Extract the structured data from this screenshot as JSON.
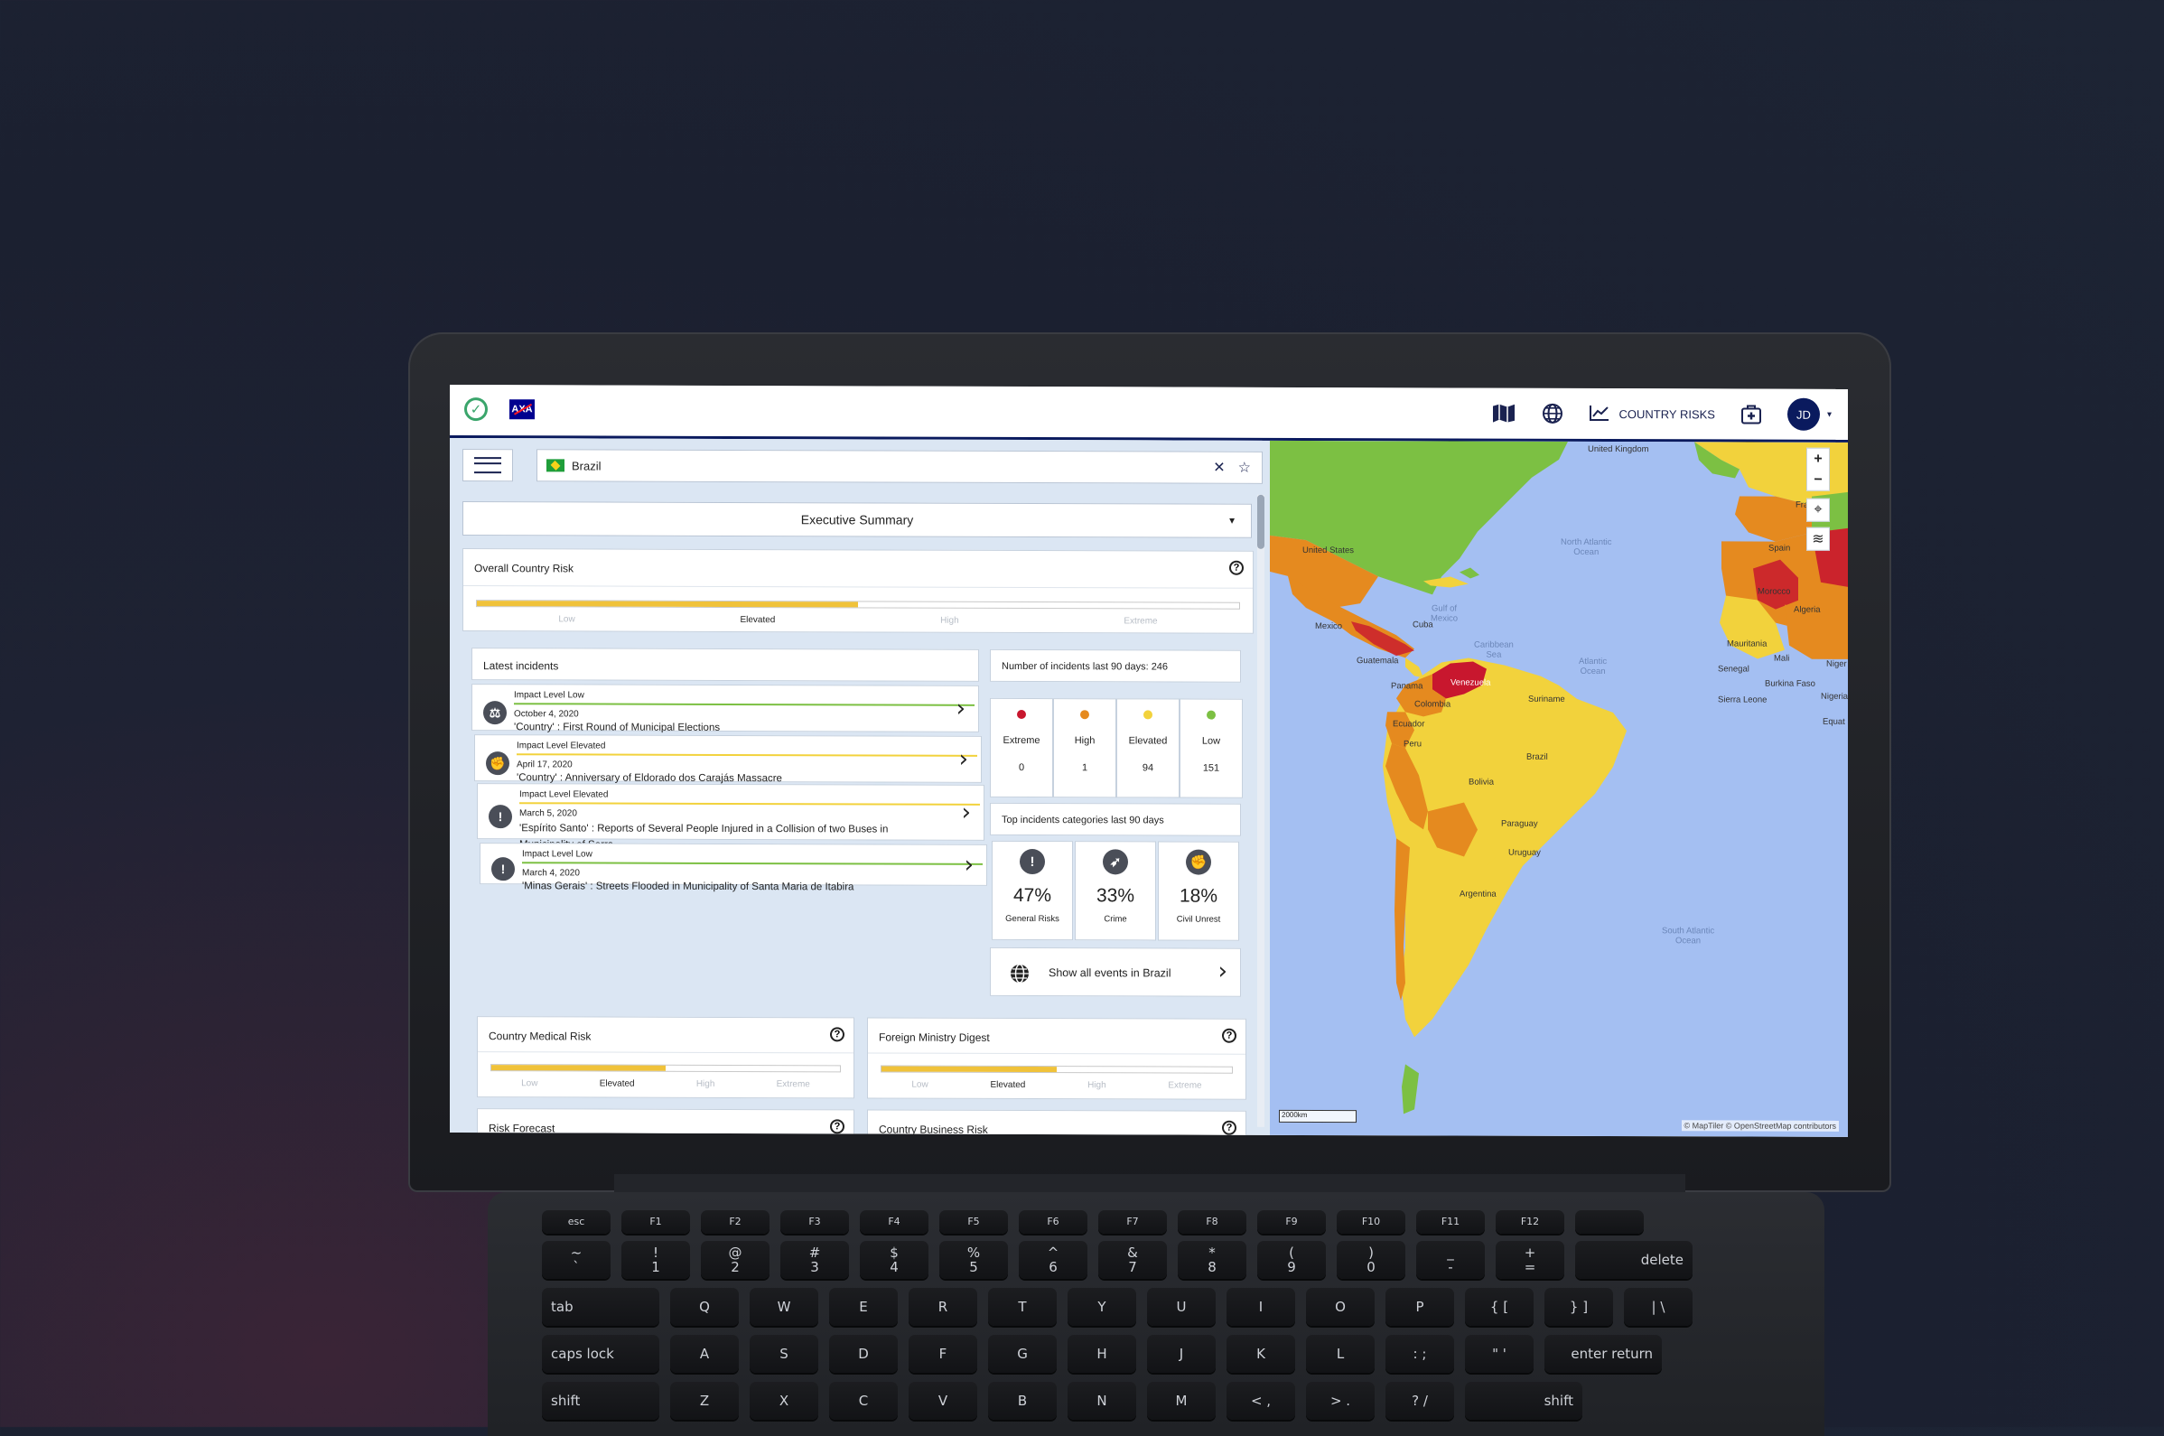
{
  "app": {
    "nav": {
      "country_risks": "COUNTRY RISKS",
      "avatar_initials": "JD",
      "icons": [
        "map-icon",
        "globe-icon",
        "chart-icon",
        "medical-kit-icon"
      ]
    },
    "brand_color": "#0a1a5e",
    "accent_green": "#3aa56b"
  },
  "search": {
    "country": "Brazil"
  },
  "section_select": {
    "value": "Executive Summary"
  },
  "overall_risk": {
    "title": "Overall Country Risk",
    "level_fraction": 0.5,
    "scale": [
      "Low",
      "Elevated",
      "High",
      "Extreme"
    ],
    "active": "Elevated"
  },
  "latest_incidents": {
    "title": "Latest incidents",
    "items": [
      {
        "level": "Impact Level Low",
        "date": "October 4, 2020",
        "title": "'Country' : First Round of Municipal Elections",
        "icon": "scales-icon"
      },
      {
        "level": "Impact Level Elevated",
        "date": "April 17, 2020",
        "title": "'Country' : Anniversary of Eldorado dos Carajás Massacre",
        "icon": "protest-fist-icon"
      },
      {
        "level": "Impact Level Elevated",
        "date": "March 5, 2020",
        "title": "'Espírito Santo' : Reports of Several People Injured in a Collision of two Buses in Municipality of Serra",
        "icon": "exclamation-icon"
      },
      {
        "level": "Impact Level Low",
        "date": "March 4, 2020",
        "title": "'Minas Gerais' : Streets Flooded in Municipality of Santa Maria de Itabira",
        "icon": "exclamation-icon"
      }
    ]
  },
  "incident_counts": {
    "title": "Number of incidents last 90 days: 246",
    "items": [
      {
        "label": "Extreme",
        "count": "0",
        "color": "#c8172e"
      },
      {
        "label": "High",
        "count": "1",
        "color": "#e58a1f"
      },
      {
        "label": "Elevated",
        "count": "94",
        "color": "#f2d23c"
      },
      {
        "label": "Low",
        "count": "151",
        "color": "#7cc043"
      }
    ]
  },
  "top_categories": {
    "title": "Top incidents categories last 90 days",
    "items": [
      {
        "pct": "47%",
        "label": "General Risks",
        "icon": "exclamation-icon"
      },
      {
        "pct": "33%",
        "label": "Crime",
        "icon": "gun-icon"
      },
      {
        "pct": "18%",
        "label": "Civil Unrest",
        "icon": "protest-fist-icon"
      }
    ]
  },
  "show_all": {
    "label": "Show all events in Brazil"
  },
  "medical_risk": {
    "title": "Country Medical Risk",
    "level_fraction": 0.5,
    "scale": [
      "Low",
      "Elevated",
      "High",
      "Extreme"
    ],
    "active": "Elevated"
  },
  "foreign_ministry": {
    "title": "Foreign Ministry Digest",
    "level_fraction": 0.5,
    "scale": [
      "Low",
      "Elevated",
      "High",
      "Extreme"
    ],
    "active": "Elevated"
  },
  "risk_forecast": {
    "title": "Risk Forecast"
  },
  "business_risk": {
    "title": "Country Business Risk"
  },
  "map": {
    "labels": {
      "united_kingdom": "United Kingdom",
      "france": "France",
      "spain": "Spain",
      "morocco": "Morocco",
      "algeria": "Algeria",
      "mauritania": "Mauritania",
      "mali": "Mali",
      "senegal": "Senegal",
      "burkina_faso": "Burkina Faso",
      "sierra_leone": "Sierra Leone",
      "nigeria": "Nigeria",
      "niger": "Niger",
      "united_states": "United States",
      "mexico": "Mexico",
      "cuba": "Cuba",
      "guatemala": "Guatemala",
      "panama": "Panama",
      "venezuela": "Venezuela",
      "colombia": "Colombia",
      "suriname": "Suriname",
      "ecuador": "Ecuador",
      "peru": "Peru",
      "brazil": "Brazil",
      "bolivia": "Bolivia",
      "paraguay": "Paraguay",
      "uruguay": "Uruguay",
      "argentina": "Argentina",
      "equat": "Equat"
    },
    "oceans": {
      "north_atlantic": "North Atlantic\nOcean",
      "gulf_mexico": "Gulf of\nMexico",
      "caribbean": "Caribbean\nSea",
      "atlantic": "Atlantic\nOcean",
      "south_atlantic": "South Atlantic\nOcean"
    },
    "scale": "2000km",
    "attribution": "© MapTiler © OpenStreetMap contributors",
    "controls": {
      "zoom_in": "+",
      "zoom_out": "−"
    }
  },
  "keyboard": {
    "fn_row": [
      "esc",
      "F1",
      "F2",
      "F3",
      "F4",
      "F5",
      "F6",
      "F7",
      "F8",
      "F9",
      "F10",
      "F11",
      "F12",
      ""
    ],
    "num_row": [
      [
        "~",
        "`"
      ],
      [
        "!",
        "1"
      ],
      [
        "@",
        "2"
      ],
      [
        "#",
        "3"
      ],
      [
        "$",
        "4"
      ],
      [
        "%",
        "5"
      ],
      [
        "^",
        "6"
      ],
      [
        "&",
        "7"
      ],
      [
        "*",
        "8"
      ],
      [
        "(",
        "9"
      ],
      [
        ")",
        "0"
      ],
      [
        "_",
        "-"
      ],
      [
        "+",
        "="
      ],
      [
        "",
        "delete"
      ]
    ],
    "row_q": [
      "tab",
      "Q",
      "W",
      "E",
      "R",
      "T",
      "Y",
      "U",
      "I",
      "O",
      "P",
      "{ [",
      "} ]",
      "| \\"
    ],
    "row_a": [
      "caps lock",
      "A",
      "S",
      "D",
      "F",
      "G",
      "H",
      "J",
      "K",
      "L",
      ": ;",
      "\" '",
      "enter return"
    ],
    "row_z": [
      "shift",
      "Z",
      "X",
      "C",
      "V",
      "B",
      "N",
      "M",
      "< ,",
      "> .",
      "? /",
      "shift"
    ]
  }
}
